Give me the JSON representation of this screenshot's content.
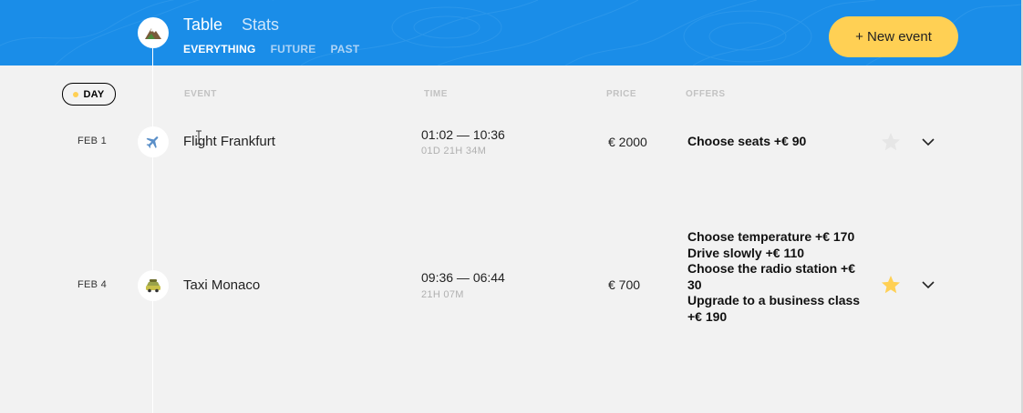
{
  "header": {
    "tabs": [
      {
        "label": "Table",
        "active": true
      },
      {
        "label": "Stats",
        "active": false
      }
    ],
    "filters": [
      {
        "label": "EVERYTHING",
        "active": true
      },
      {
        "label": "FUTURE",
        "active": false
      },
      {
        "label": "PAST",
        "active": false
      }
    ],
    "new_event_label": "+ New event",
    "logo_icon": "mountain-icon"
  },
  "sort": {
    "day_label": "DAY",
    "columns": [
      "EVENT",
      "TIME",
      "PRICE",
      "OFFERS"
    ]
  },
  "events": [
    {
      "date": "FEB 1",
      "icon": "airplane-icon",
      "title": "Flight Frankfurt",
      "time": "01:02 — 10:36",
      "duration": "01D 21H 34M",
      "price": "€ 2000",
      "offers": [
        "Choose seats +€  90"
      ],
      "favorite": false
    },
    {
      "date": "FEB 4",
      "icon": "taxi-icon",
      "title": "Taxi Monaco",
      "time": "09:36 — 06:44",
      "duration": "21H 07M",
      "price": "€ 700",
      "offers": [
        "Choose temperature +€  170",
        "Drive slowly +€  110",
        "Choose the radio station +€  30",
        "Upgrade to a business class +€  190"
      ],
      "favorite": true
    }
  ],
  "colors": {
    "header_bg": "#1a8de8",
    "accent": "#ffd054",
    "page_bg": "#f2f2f2",
    "star_active": "#ffd054",
    "star_inactive": "#e6e6e6"
  }
}
